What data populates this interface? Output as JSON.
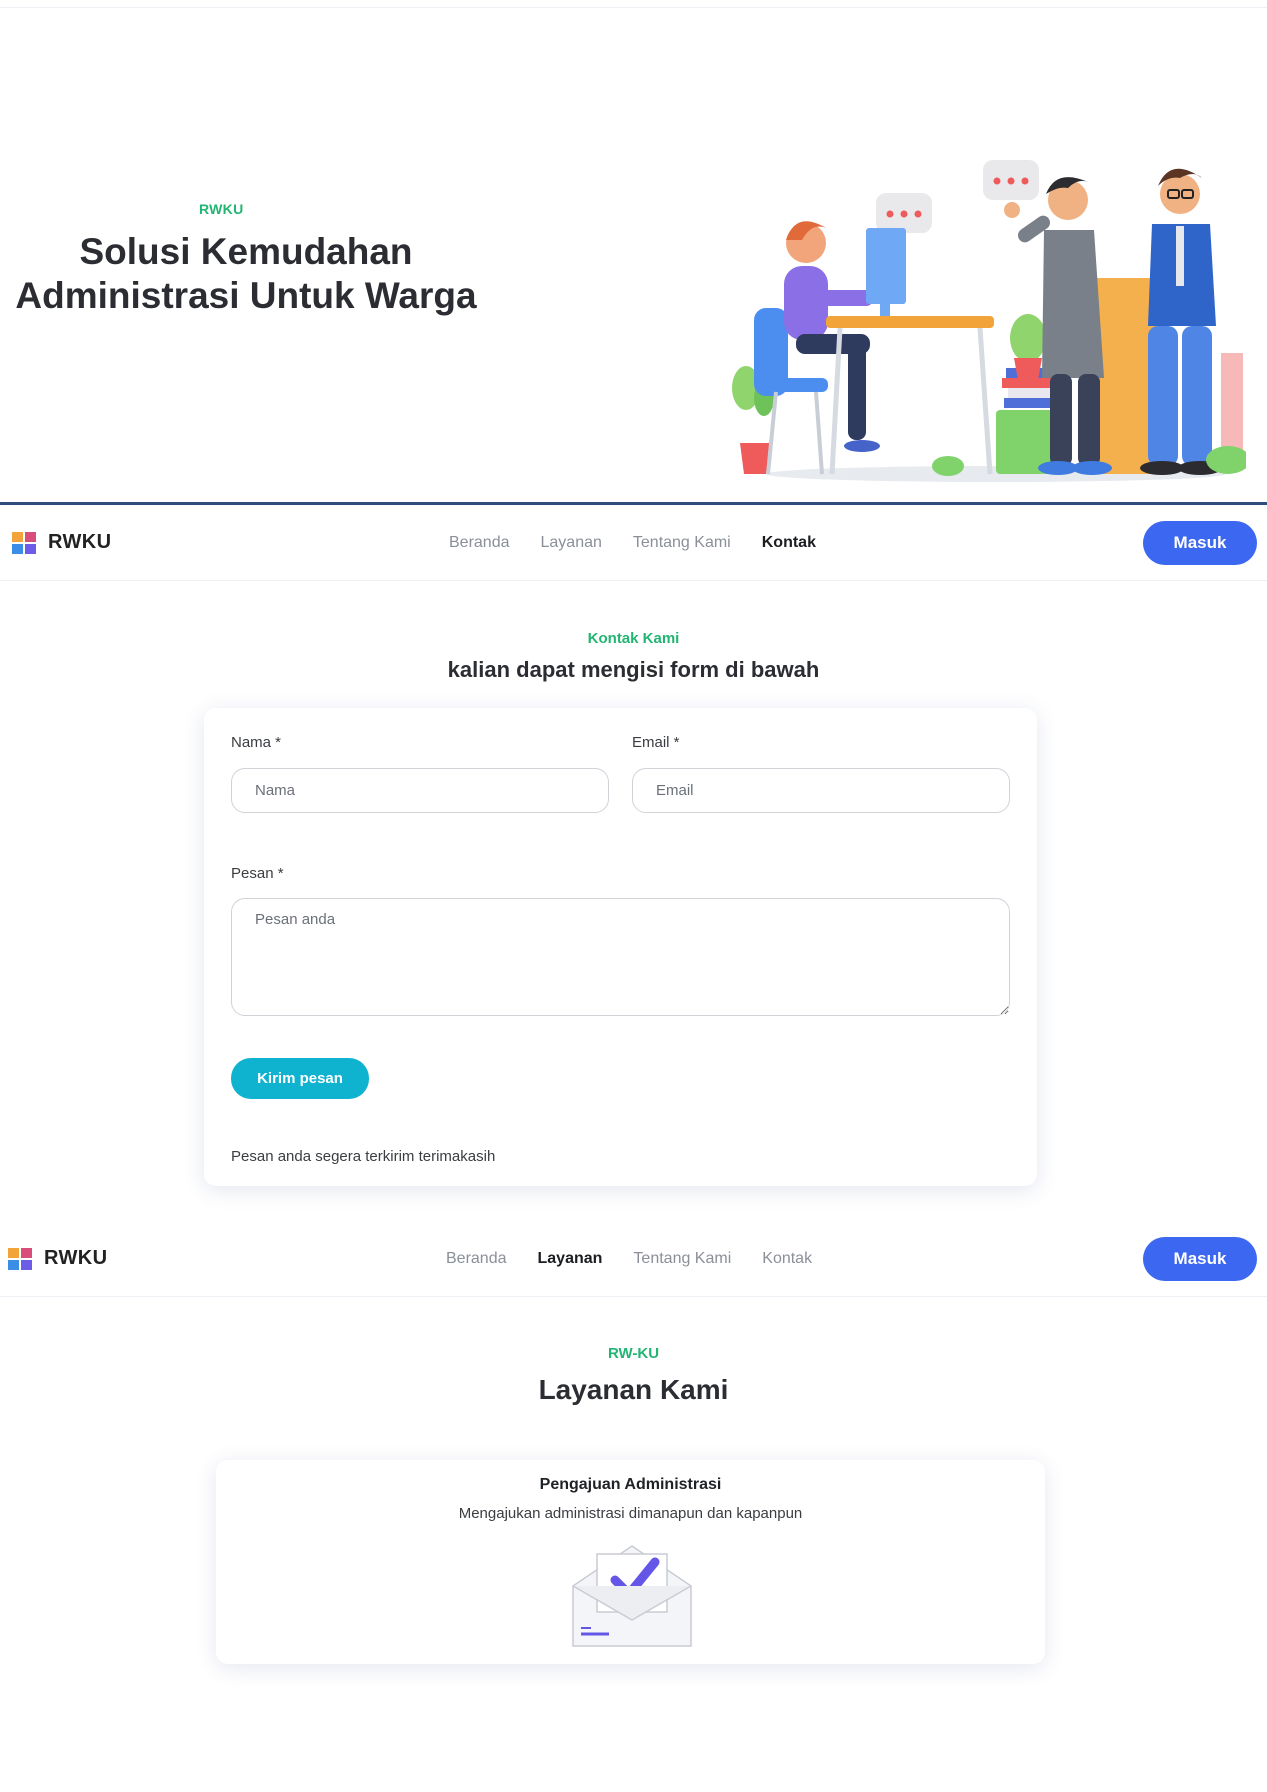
{
  "brand": {
    "name": "RWKU"
  },
  "hero": {
    "tag": "RWKU",
    "title_line1": "Solusi Kemudahan",
    "title_line2": "Administrasi Untuk Warga",
    "illustration": "office-team-illustration"
  },
  "nav_contact": {
    "links": [
      "Beranda",
      "Layanan",
      "Tentang Kami",
      "Kontak"
    ],
    "active": "Kontak",
    "login_label": "Masuk"
  },
  "contact": {
    "tag": "Kontak Kami",
    "heading": "kalian dapat mengisi form di bawah",
    "name_label": "Nama *",
    "name_placeholder": "Nama",
    "email_label": "Email *",
    "email_placeholder": "Email",
    "message_label": "Pesan *",
    "message_placeholder": "Pesan anda",
    "submit_label": "Kirim pesan",
    "note": "Pesan anda segera terkirim terimakasih"
  },
  "nav_services": {
    "links": [
      "Beranda",
      "Layanan",
      "Tentang Kami",
      "Kontak"
    ],
    "active": "Layanan",
    "login_label": "Masuk"
  },
  "services": {
    "tag": "RW-KU",
    "heading": "Layanan Kami",
    "items": [
      {
        "title": "Pengajuan Administrasi",
        "description": "Mengajukan administrasi dimanapun dan kapanpun",
        "icon": "envelope-check-icon"
      }
    ]
  },
  "colors": {
    "accent_green": "#22b573",
    "primary_blue": "#3c67f0",
    "submit_cyan": "#0fb2cf",
    "divider_navy": "#2f4d7a"
  }
}
